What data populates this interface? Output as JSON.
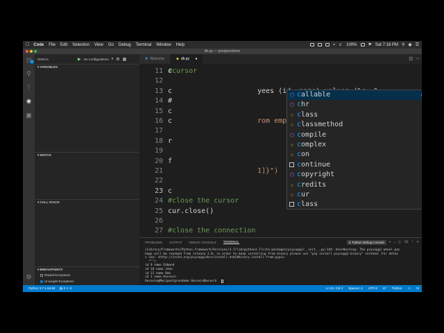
{
  "menubar": {
    "app": "Code",
    "menus": [
      "File",
      "Edit",
      "Selection",
      "View",
      "Go",
      "Debug",
      "Terminal",
      "Window",
      "Help"
    ],
    "battery": "100%",
    "clock": "Sat 7:18 PM"
  },
  "window": {
    "title": "db.py — postgresdemo"
  },
  "debug": {
    "label": "DEBUG",
    "config": "No Configurations",
    "sections": {
      "variables": "VARIABLES",
      "watch": "WATCH",
      "callstack": "CALL STACK",
      "breakpoints": "BREAKPOINTS"
    },
    "breakpoints": [
      {
        "label": "Raised Exceptions",
        "checked": false
      },
      {
        "label": "Uncaught Exceptions",
        "checked": true
      }
    ]
  },
  "tabs": [
    {
      "label": "Welcome",
      "active": false
    },
    {
      "label": "db.py",
      "active": true
    }
  ],
  "editor": {
    "top_comment": "#cursor",
    "lines": [
      {
        "n": "11",
        "text": "c"
      },
      {
        "n": "12",
        "text": ""
      },
      {
        "n": "13",
        "text": "c",
        "tail": "yees (id, name) values (%s, %"
      },
      {
        "n": "14",
        "text": "#"
      },
      {
        "n": "15",
        "text": "c"
      },
      {
        "n": "16",
        "text": "c",
        "tail": "rom employees\")"
      },
      {
        "n": "17",
        "text": ""
      },
      {
        "n": "18",
        "text": "r"
      },
      {
        "n": "19",
        "text": ""
      },
      {
        "n": "20",
        "text": "f"
      },
      {
        "n": "21",
        "text": "",
        "tail": "1]}\")"
      },
      {
        "n": "22",
        "text": ""
      },
      {
        "n": "23",
        "text": "c"
      },
      {
        "n": "24",
        "text": "#close the cursor"
      },
      {
        "n": "25",
        "text": "cur.close()"
      },
      {
        "n": "26",
        "text": ""
      },
      {
        "n": "27",
        "text": "#close the connection"
      }
    ],
    "suggestions": [
      {
        "label": "callable",
        "kind": "func"
      },
      {
        "label": "chr",
        "kind": "func"
      },
      {
        "label": "class",
        "kind": "cls"
      },
      {
        "label": "classmethod",
        "kind": "cls"
      },
      {
        "label": "compile",
        "kind": "func"
      },
      {
        "label": "complex",
        "kind": "cls"
      },
      {
        "label": "con",
        "kind": "cls"
      },
      {
        "label": "continue",
        "kind": "kw"
      },
      {
        "label": "copyright",
        "kind": "func"
      },
      {
        "label": "credits",
        "kind": "cls"
      },
      {
        "label": "cur",
        "kind": "cls"
      },
      {
        "label": "class",
        "kind": "kw"
      }
    ]
  },
  "panel": {
    "tabs": [
      "PROBLEMS",
      "OUTPUT",
      "DEBUG CONSOLE",
      "TERMINAL"
    ],
    "active_tab": "TERMINAL",
    "terminal_select": "3: Python Debug Console",
    "terminal_lines": [
      "/Library/Frameworks/Python.framework/Versions/3.7/lib/python3.7/site-packages/psycopg2/__init__.py:144: UserWarning: The psycopg2 wheel pac",
      "kage will be renamed from release 2.8; in order to keep installing from binary please use \"pip install psycopg2-binary\" instead. For detai",
      "s see: <http://initd.org/psycopg/docs/install.html#binary-install-from-pypi>.",
      "  \"\"\")",
      "id 9 name Edmond",
      "id 10 name John",
      "id 11 name Bob",
      "id 1 name Hussein",
      "Hussein@Macipostgresdemo HusseinNasser$ "
    ]
  },
  "status": {
    "python": "Python 3.7.1 64-bit",
    "errors": "0",
    "warnings": "0",
    "position": "Ln 23, Col 2",
    "spaces": "Spaces: 4",
    "encoding": "UTF-8",
    "eol": "LF",
    "language": "Python"
  }
}
